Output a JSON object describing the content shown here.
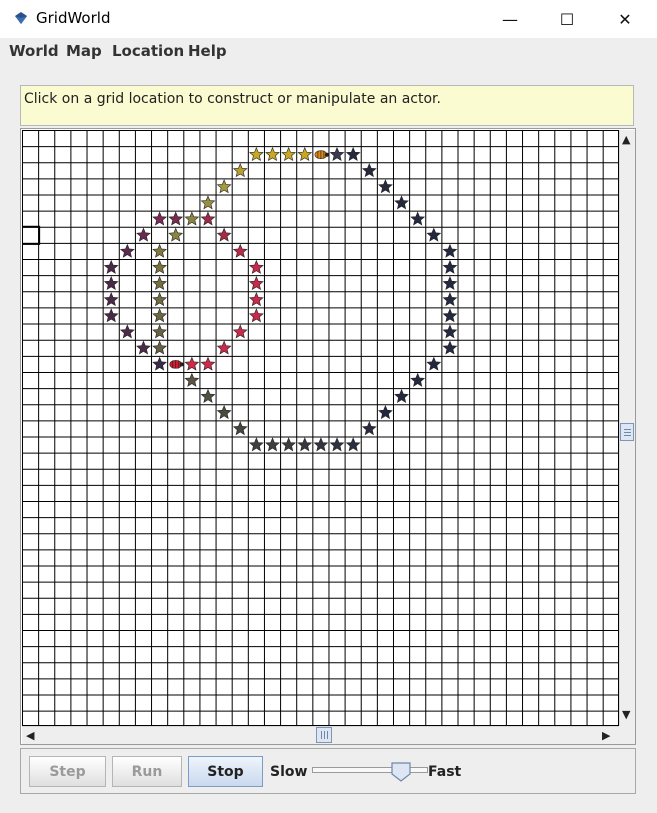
{
  "window": {
    "title": "GridWorld"
  },
  "window_controls": {
    "minimize": "—",
    "maximize": "☐",
    "close": "✕"
  },
  "menu": [
    {
      "label": "World"
    },
    {
      "label": "Map"
    },
    {
      "label": "Location"
    },
    {
      "label": "Help"
    }
  ],
  "hint_text": "Click on a grid location to construct or manipulate an actor.",
  "grid": {
    "cols": 37,
    "rows": 37,
    "selected_cell": {
      "col": 0,
      "row": 6
    },
    "flowers": [
      {
        "col": 14,
        "row": 1,
        "color": "#c8a726"
      },
      {
        "col": 15,
        "row": 1,
        "color": "#c8a726"
      },
      {
        "col": 16,
        "row": 1,
        "color": "#c8a726"
      },
      {
        "col": 17,
        "row": 1,
        "color": "#c8a726"
      },
      {
        "col": 19,
        "row": 1,
        "color": "#3a3a52"
      },
      {
        "col": 20,
        "row": 1,
        "color": "#24293e"
      },
      {
        "col": 13,
        "row": 2,
        "color": "#b8a030"
      },
      {
        "col": 21,
        "row": 2,
        "color": "#24293e"
      },
      {
        "col": 12,
        "row": 3,
        "color": "#a89a3a"
      },
      {
        "col": 22,
        "row": 3,
        "color": "#24293e"
      },
      {
        "col": 11,
        "row": 4,
        "color": "#9a8f3e"
      },
      {
        "col": 23,
        "row": 4,
        "color": "#24293e"
      },
      {
        "col": 8,
        "row": 5,
        "color": "#7a2a55"
      },
      {
        "col": 9,
        "row": 5,
        "color": "#7a2a4a"
      },
      {
        "col": 10,
        "row": 5,
        "color": "#8a8540"
      },
      {
        "col": 11,
        "row": 5,
        "color": "#9a2a48"
      },
      {
        "col": 24,
        "row": 5,
        "color": "#24293e"
      },
      {
        "col": 7,
        "row": 6,
        "color": "#6a2a50"
      },
      {
        "col": 9,
        "row": 6,
        "color": "#8a8540"
      },
      {
        "col": 12,
        "row": 6,
        "color": "#a82a45"
      },
      {
        "col": 25,
        "row": 6,
        "color": "#24293e"
      },
      {
        "col": 6,
        "row": 7,
        "color": "#5a2a50"
      },
      {
        "col": 8,
        "row": 7,
        "color": "#807a42"
      },
      {
        "col": 13,
        "row": 7,
        "color": "#b82a45"
      },
      {
        "col": 26,
        "row": 7,
        "color": "#24293e"
      },
      {
        "col": 5,
        "row": 8,
        "color": "#4a2a48"
      },
      {
        "col": 8,
        "row": 8,
        "color": "#7a7442"
      },
      {
        "col": 14,
        "row": 8,
        "color": "#c82a48"
      },
      {
        "col": 26,
        "row": 8,
        "color": "#24293e"
      },
      {
        "col": 5,
        "row": 9,
        "color": "#4a2a48"
      },
      {
        "col": 8,
        "row": 9,
        "color": "#757042"
      },
      {
        "col": 14,
        "row": 9,
        "color": "#c82a48"
      },
      {
        "col": 26,
        "row": 9,
        "color": "#24293e"
      },
      {
        "col": 5,
        "row": 10,
        "color": "#4a2a48"
      },
      {
        "col": 8,
        "row": 10,
        "color": "#706c42"
      },
      {
        "col": 14,
        "row": 10,
        "color": "#c82a48"
      },
      {
        "col": 26,
        "row": 10,
        "color": "#24293e"
      },
      {
        "col": 5,
        "row": 11,
        "color": "#4a2a48"
      },
      {
        "col": 8,
        "row": 11,
        "color": "#6c6842"
      },
      {
        "col": 14,
        "row": 11,
        "color": "#c82a48"
      },
      {
        "col": 26,
        "row": 11,
        "color": "#24293e"
      },
      {
        "col": 6,
        "row": 12,
        "color": "#4a2a48"
      },
      {
        "col": 8,
        "row": 12,
        "color": "#686442"
      },
      {
        "col": 13,
        "row": 12,
        "color": "#c82a48"
      },
      {
        "col": 26,
        "row": 12,
        "color": "#24293e"
      },
      {
        "col": 7,
        "row": 13,
        "color": "#4a2a48"
      },
      {
        "col": 8,
        "row": 13,
        "color": "#646042"
      },
      {
        "col": 12,
        "row": 13,
        "color": "#c82a48"
      },
      {
        "col": 26,
        "row": 13,
        "color": "#24293e"
      },
      {
        "col": 8,
        "row": 14,
        "color": "#3a2a48"
      },
      {
        "col": 10,
        "row": 14,
        "color": "#d02a48"
      },
      {
        "col": 11,
        "row": 14,
        "color": "#d02a48"
      },
      {
        "col": 25,
        "row": 14,
        "color": "#24293e"
      },
      {
        "col": 10,
        "row": 15,
        "color": "#5a5640"
      },
      {
        "col": 24,
        "row": 15,
        "color": "#24293e"
      },
      {
        "col": 11,
        "row": 16,
        "color": "#52503e"
      },
      {
        "col": 23,
        "row": 16,
        "color": "#24293e"
      },
      {
        "col": 12,
        "row": 17,
        "color": "#4c4a3e"
      },
      {
        "col": 22,
        "row": 17,
        "color": "#24293e"
      },
      {
        "col": 13,
        "row": 18,
        "color": "#46443e"
      },
      {
        "col": 21,
        "row": 18,
        "color": "#2a2c3e"
      },
      {
        "col": 14,
        "row": 19,
        "color": "#42403e"
      },
      {
        "col": 15,
        "row": 19,
        "color": "#3e3e3e"
      },
      {
        "col": 16,
        "row": 19,
        "color": "#3a3c3e"
      },
      {
        "col": 17,
        "row": 19,
        "color": "#36383e"
      },
      {
        "col": 18,
        "row": 19,
        "color": "#32343e"
      },
      {
        "col": 19,
        "row": 19,
        "color": "#2e323e"
      },
      {
        "col": 20,
        "row": 19,
        "color": "#2a2e3e"
      }
    ],
    "bugs": [
      {
        "col": 18,
        "row": 1,
        "color": "#e08a10"
      },
      {
        "col": 9,
        "row": 14,
        "color": "#d81e2e"
      }
    ]
  },
  "controls": {
    "step_label": "Step",
    "run_label": "Run",
    "stop_label": "Stop",
    "slow_label": "Slow",
    "fast_label": "Fast",
    "speed_fraction": 0.82
  }
}
